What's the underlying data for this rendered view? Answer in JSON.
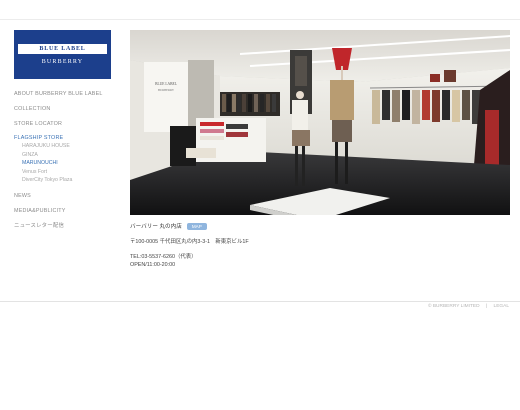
{
  "brand": {
    "line1": "BLUE LABEL",
    "line2": "BURBERRY",
    "color": "#1c3f8c"
  },
  "nav": {
    "items": [
      {
        "label": "ABOUT BURBERRY BLUE LABEL"
      },
      {
        "label": "COLLECTION"
      },
      {
        "label": "STORE LOCATOR"
      }
    ],
    "flagship": {
      "label": "FLAGSHIP STORE",
      "subs": [
        {
          "label": "HARAJUKU HOUSE"
        },
        {
          "label": "GINZA"
        },
        {
          "label": "MARUNOUCHI"
        },
        {
          "label": "Venus Fort"
        },
        {
          "label": "DiverCity Tokyo Plaza"
        }
      ]
    },
    "bottom": [
      {
        "label": "NEWS"
      },
      {
        "label": "MEDIA&PUBLICITY"
      },
      {
        "label": "ニュースレター配信"
      }
    ],
    "active_color": "#3a72b5"
  },
  "store": {
    "name": "バーバリー 丸の内店",
    "map_label": "MAP",
    "address": "〒100-0005 千代田区丸の内3-3-1　新東京ビル1F",
    "tel": "TEL:03-5537-6260（代表）",
    "open": "OPEN/11:00-20:00"
  },
  "footer": {
    "copyright": "© BURBERRY LIMITED",
    "legal": "LEGAL"
  },
  "photo": {
    "wall_sign_line1": "BLUE LABEL",
    "wall_sign_line2": "BURBERRY"
  }
}
